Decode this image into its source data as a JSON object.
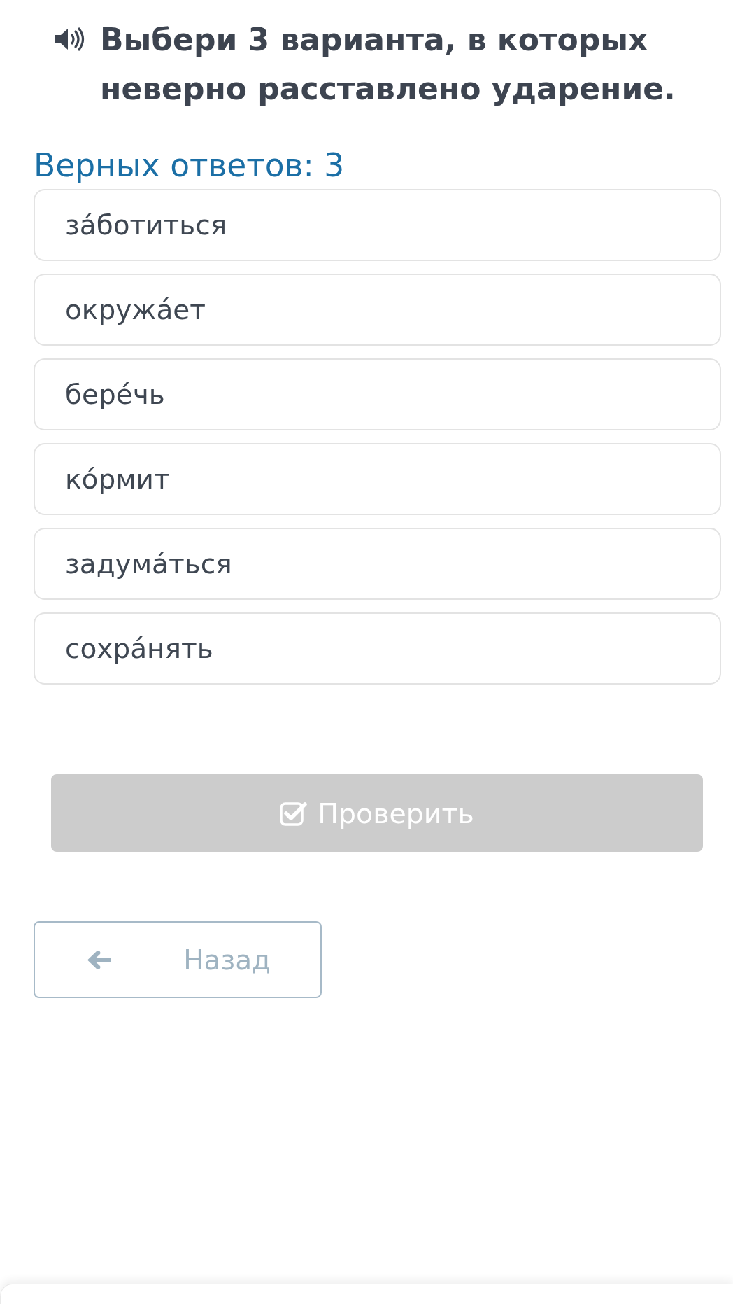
{
  "question": {
    "text": "Выбери 3 варианта, в которых неверно расставлено ударение."
  },
  "answer_count": "Верных ответов: 3",
  "options": [
    {
      "text": "за́ботиться",
      "selected": false
    },
    {
      "text": "окружа́ет",
      "selected": false
    },
    {
      "text": "бере́чь",
      "selected": false
    },
    {
      "text": "ко́рмит",
      "selected": false
    },
    {
      "text": "задума́ться",
      "selected": false
    },
    {
      "text": "сохра́нять",
      "selected": false
    }
  ],
  "check_button": {
    "label": "Проверить",
    "disabled": true
  },
  "back_button": {
    "label": "Назад"
  }
}
